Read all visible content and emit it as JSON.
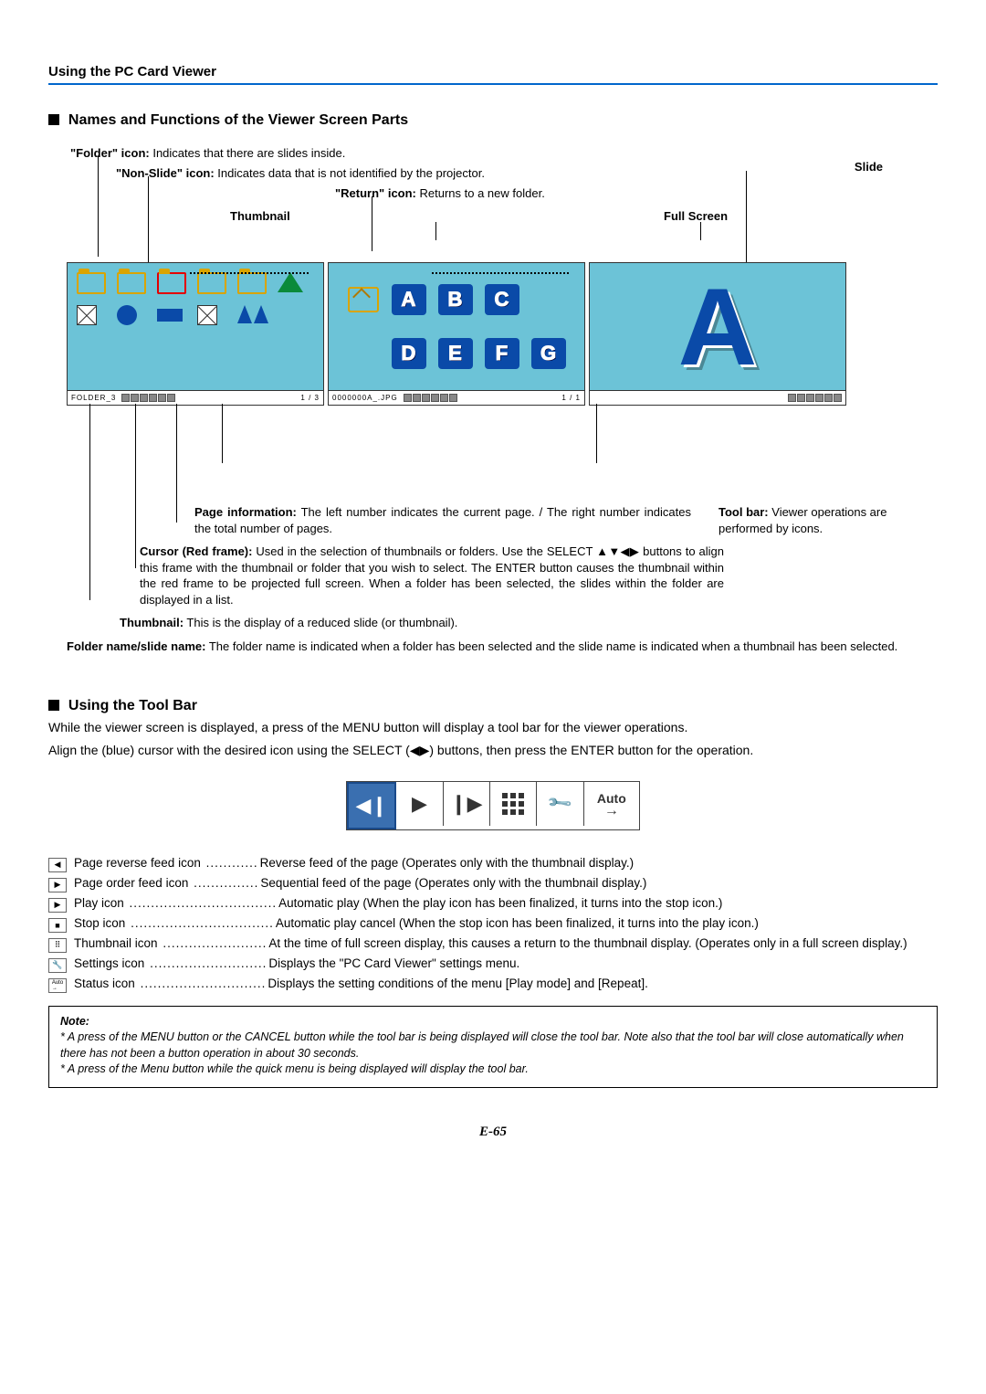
{
  "header": {
    "title": "Using the PC Card Viewer"
  },
  "section1": {
    "title": "Names and Functions of the Viewer Screen Parts",
    "callouts": {
      "folder_icon": {
        "label": "\"Folder\" icon:",
        "desc": " Indicates that there are slides inside."
      },
      "nonslide_icon": {
        "label": "\"Non-Slide\" icon:",
        "desc": " Indicates data that is not identified by the projector."
      },
      "return_icon": {
        "label": "\"Return\" icon:",
        "desc": " Returns to a new folder."
      },
      "thumbnail_label": "Thumbnail",
      "fullscreen_label": "Full Screen",
      "slide_label": "Slide"
    },
    "thumb_panel": {
      "status_left": "FOLDER_3",
      "page_info": "1 / 3"
    },
    "mid_panel": {
      "status_left": "0000000A_.JPG",
      "page_info": "1 / 1",
      "letters": [
        "A",
        "B",
        "C",
        "D",
        "E",
        "F",
        "G"
      ]
    },
    "descriptions": {
      "page_info": {
        "label": "Page information:",
        "desc": " The left number indicates the current page. / The right number indicates the total number of pages."
      },
      "toolbar": {
        "label": "Tool bar:",
        "desc": " Viewer operations are performed by icons."
      },
      "cursor": {
        "label": "Cursor (Red frame):",
        "desc": " Used in the selection of thumbnails or folders. Use the SELECT ▲▼◀▶ buttons to align this frame with the thumbnail or folder that you wish to select. The ENTER button causes the thumbnail within the red frame to be projected full screen. When a folder has been selected, the slides within the folder are displayed in a list."
      },
      "thumbnail": {
        "label": "Thumbnail:",
        "desc": " This is the display of a reduced slide (or thumbnail)."
      },
      "folder_slide_name": {
        "label": "Folder name/slide name:",
        "desc": " The folder name is indicated when a folder has been selected and the slide name is indicated when a thumbnail has been selected."
      }
    }
  },
  "section2": {
    "title": "Using the Tool Bar",
    "intro1": "While the viewer screen is displayed, a press of the MENU button will display a tool bar for the viewer operations.",
    "intro2": "Align the (blue) cursor with the desired icon using the SELECT (◀▶) buttons, then press the ENTER button for the operation.",
    "toolbar_auto_label": "Auto",
    "defs": [
      {
        "icon": "◀❙",
        "label": "Page reverse feed icon",
        "dots": "............",
        "desc": "Reverse feed of the page (Operates only with the thumbnail display.)"
      },
      {
        "icon": "❙▶",
        "label": "Page order feed icon",
        "dots": "...............",
        "desc": "Sequential feed of the page (Operates only with the thumbnail display.)"
      },
      {
        "icon": "▶",
        "label": "Play icon",
        "dots": "..................................",
        "desc": "Automatic play (When the play icon has been finalized, it turns into the stop icon.)"
      },
      {
        "icon": "■",
        "label": "Stop icon",
        "dots": ".................................",
        "desc": "Automatic play cancel (When the stop icon has been finalized, it turns into the play icon.)"
      },
      {
        "icon": "⠿",
        "label": "Thumbnail icon",
        "dots": "........................",
        "desc": "At the time of full screen display, this causes a return to the thumbnail display. (Operates only in a full screen display.)"
      },
      {
        "icon": "🔧",
        "label": "Settings icon",
        "dots": "...........................",
        "desc": "Displays the \"PC Card Viewer\" settings menu."
      },
      {
        "icon": "Auto",
        "label": "Status icon",
        "dots": ".............................",
        "desc": "Displays the setting conditions of the menu [Play mode] and [Repeat]."
      }
    ]
  },
  "note": {
    "title": "Note:",
    "items": [
      "A press of the MENU button or the CANCEL button while the tool bar is being displayed will close the tool bar. Note also that the tool bar will close automatically when there has not been a button operation in about 30 seconds.",
      "A press of the Menu button while the quick menu is being displayed will display the tool bar."
    ]
  },
  "page_number": "E-65"
}
